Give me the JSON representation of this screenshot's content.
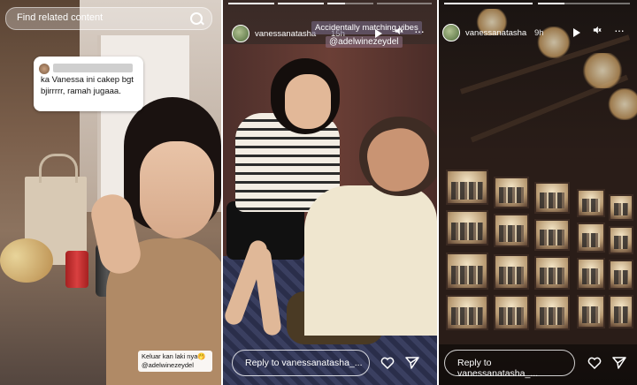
{
  "panel1": {
    "search_placeholder": "Find related content",
    "comment_text": "ka Vanessa ini cakep bgt bjirrrrr, ramah jugaaa.",
    "caption": "Keluar kan laki nya🤭 @adelwinezeydel"
  },
  "panel2": {
    "username": "vanessanatasha",
    "time": "15h",
    "sticker_text": "Accidentally matching vibes",
    "mention": "@adelwinezeydel",
    "reply_placeholder": "Reply to vanessanatasha_..."
  },
  "panel3": {
    "username": "vanessanatasha",
    "time": "9h",
    "reply_placeholder": "Reply to vanessanatasha_..."
  },
  "icons": {
    "search": "search-icon",
    "play": "play-icon",
    "mute": "mute-icon",
    "more": "more-icon",
    "heart": "heart-icon",
    "send": "send-icon"
  }
}
